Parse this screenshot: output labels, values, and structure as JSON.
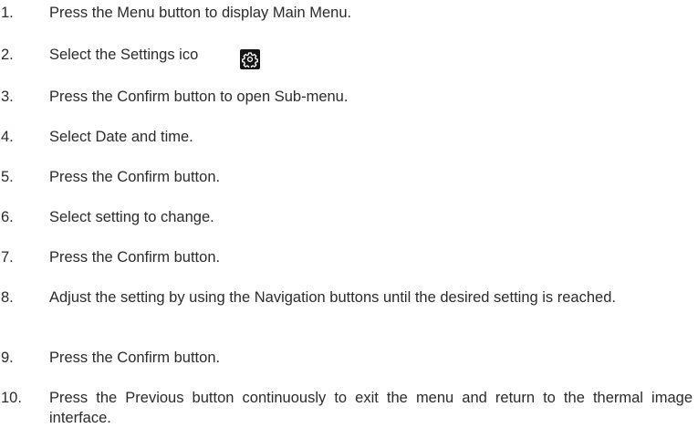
{
  "steps": [
    {
      "number": "1.",
      "text": "Press the Menu button to display Main Menu."
    },
    {
      "number": "2.",
      "text": "Select the Settings ico"
    },
    {
      "number": "3.",
      "text": "Press the Confirm button to open Sub-menu."
    },
    {
      "number": "4.",
      "text": "Select Date and time."
    },
    {
      "number": "5.",
      "text": "Press the Confirm button."
    },
    {
      "number": "6.",
      "text": "Select setting to change."
    },
    {
      "number": "7.",
      "text": "Press the Confirm button."
    },
    {
      "number": "8.",
      "text": "Adjust the setting by using the Navigation buttons until the desired setting is reached."
    },
    {
      "number": "9.",
      "text": "Press the Confirm button."
    },
    {
      "number": "10.",
      "text": "Press the Previous button continuously to exit the menu and return to the thermal image interface."
    }
  ],
  "icons": {
    "settings": "gear-icon"
  }
}
